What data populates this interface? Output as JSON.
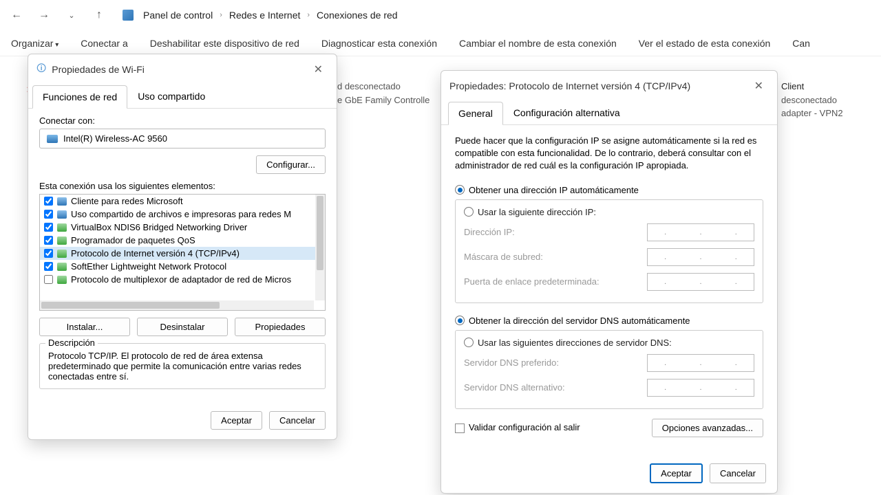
{
  "breadcrumb": {
    "a": "Panel de control",
    "b": "Redes e Internet",
    "c": "Conexiones de red"
  },
  "toolbar": {
    "organize": "Organizar",
    "connect": "Conectar a",
    "disable": "Deshabilitar este dispositivo de red",
    "diagnose": "Diagnosticar esta conexión",
    "rename": "Cambiar el nombre de esta conexión",
    "status": "Ver el estado de esta conexión",
    "more": "Can"
  },
  "bg": {
    "mid1": "d desconectado",
    "mid2": "e GbE Family Controlle",
    "r1": "Client",
    "r2": "desconectado",
    "r3": "adapter - VPN2"
  },
  "wifi": {
    "title": "Propiedades de Wi-Fi",
    "tab1": "Funciones de red",
    "tab2": "Uso compartido",
    "connect_with": "Conectar con:",
    "adapter": "Intel(R) Wireless-AC 9560",
    "configure": "Configurar...",
    "uses": "Esta conexión usa los siguientes elementos:",
    "items": [
      {
        "c": true,
        "t": "Cliente para redes Microsoft"
      },
      {
        "c": true,
        "t": "Uso compartido de archivos e impresoras para redes M"
      },
      {
        "c": true,
        "t": "VirtualBox NDIS6 Bridged Networking Driver"
      },
      {
        "c": true,
        "t": "Programador de paquetes QoS"
      },
      {
        "c": true,
        "t": "Protocolo de Internet versión 4 (TCP/IPv4)"
      },
      {
        "c": true,
        "t": "SoftEther Lightweight Network Protocol"
      },
      {
        "c": false,
        "t": "Protocolo de multiplexor de adaptador de red de Micros"
      }
    ],
    "install": "Instalar...",
    "uninstall": "Desinstalar",
    "properties": "Propiedades",
    "desc_title": "Descripción",
    "desc_text": "Protocolo TCP/IP. El protocolo de red de área extensa predeterminado que permite la comunicación entre varias redes conectadas entre sí.",
    "ok": "Aceptar",
    "cancel": "Cancelar"
  },
  "ip": {
    "title": "Propiedades: Protocolo de Internet versión 4 (TCP/IPv4)",
    "tab1": "General",
    "tab2": "Configuración alternativa",
    "desc": "Puede hacer que la configuración IP se asigne automáticamente si la red es compatible con esta funcionalidad. De lo contrario, deberá consultar con el administrador de red cuál es la configuración IP apropiada.",
    "auto_ip": "Obtener una dirección IP automáticamente",
    "use_ip": "Usar la siguiente dirección IP:",
    "f_ip": "Dirección IP:",
    "f_mask": "Máscara de subred:",
    "f_gw": "Puerta de enlace predeterminada:",
    "auto_dns": "Obtener la dirección del servidor DNS automáticamente",
    "use_dns": "Usar las siguientes direcciones de servidor DNS:",
    "f_dns1": "Servidor DNS preferido:",
    "f_dns2": "Servidor DNS alternativo:",
    "validate": "Validar configuración al salir",
    "advanced": "Opciones avanzadas...",
    "ok": "Aceptar",
    "cancel": "Cancelar"
  }
}
